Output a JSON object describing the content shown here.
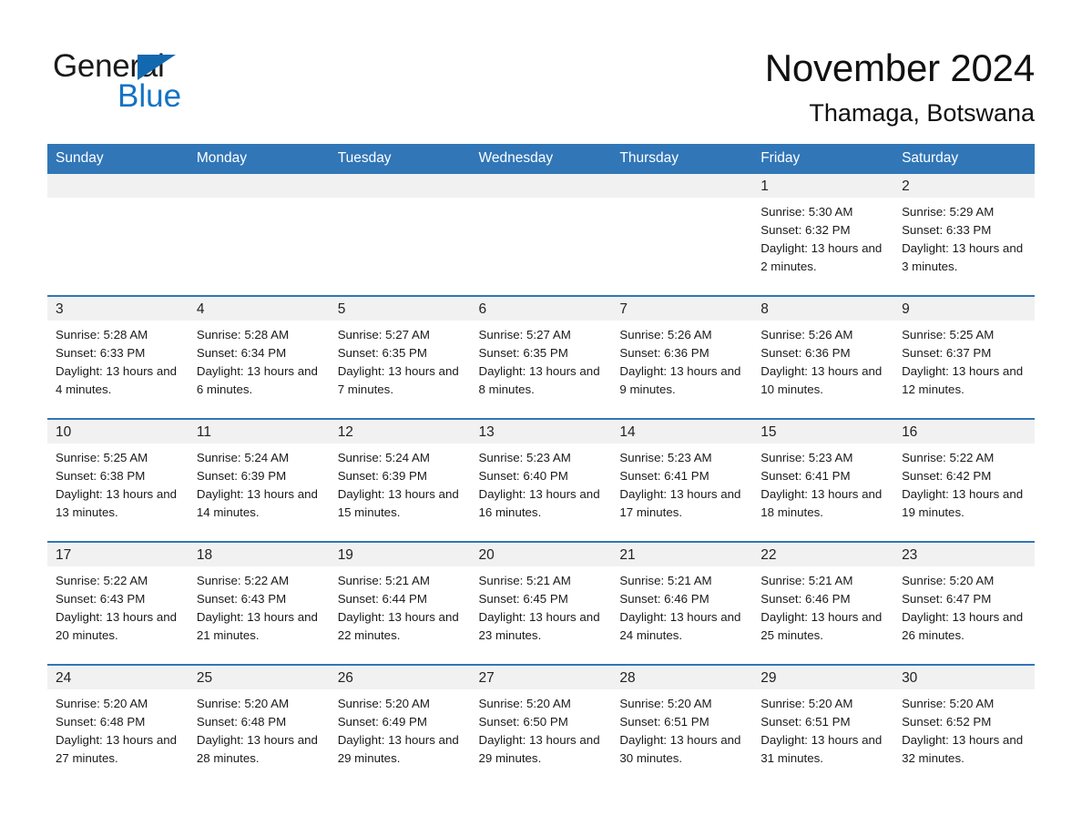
{
  "brand": {
    "name_top": "General",
    "name_bottom": "Blue",
    "triangle_color": "#1269b0",
    "blue_text_color": "#1473c4"
  },
  "header": {
    "month_title": "November 2024",
    "location": "Thamaga, Botswana"
  },
  "theme": {
    "header_blue": "#3176b7",
    "daynum_band": "#f1f1f1",
    "text": "#1a1a1a"
  },
  "weekday_headers": [
    "Sunday",
    "Monday",
    "Tuesday",
    "Wednesday",
    "Thursday",
    "Friday",
    "Saturday"
  ],
  "weeks": [
    [
      {
        "day": "",
        "sunrise": "",
        "sunset": "",
        "daylight": "",
        "empty": true
      },
      {
        "day": "",
        "sunrise": "",
        "sunset": "",
        "daylight": "",
        "empty": true
      },
      {
        "day": "",
        "sunrise": "",
        "sunset": "",
        "daylight": "",
        "empty": true
      },
      {
        "day": "",
        "sunrise": "",
        "sunset": "",
        "daylight": "",
        "empty": true
      },
      {
        "day": "",
        "sunrise": "",
        "sunset": "",
        "daylight": "",
        "empty": true
      },
      {
        "day": "1",
        "sunrise": "Sunrise: 5:30 AM",
        "sunset": "Sunset: 6:32 PM",
        "daylight": "Daylight: 13 hours and 2 minutes.",
        "empty": false
      },
      {
        "day": "2",
        "sunrise": "Sunrise: 5:29 AM",
        "sunset": "Sunset: 6:33 PM",
        "daylight": "Daylight: 13 hours and 3 minutes.",
        "empty": false
      }
    ],
    [
      {
        "day": "3",
        "sunrise": "Sunrise: 5:28 AM",
        "sunset": "Sunset: 6:33 PM",
        "daylight": "Daylight: 13 hours and 4 minutes.",
        "empty": false
      },
      {
        "day": "4",
        "sunrise": "Sunrise: 5:28 AM",
        "sunset": "Sunset: 6:34 PM",
        "daylight": "Daylight: 13 hours and 6 minutes.",
        "empty": false
      },
      {
        "day": "5",
        "sunrise": "Sunrise: 5:27 AM",
        "sunset": "Sunset: 6:35 PM",
        "daylight": "Daylight: 13 hours and 7 minutes.",
        "empty": false
      },
      {
        "day": "6",
        "sunrise": "Sunrise: 5:27 AM",
        "sunset": "Sunset: 6:35 PM",
        "daylight": "Daylight: 13 hours and 8 minutes.",
        "empty": false
      },
      {
        "day": "7",
        "sunrise": "Sunrise: 5:26 AM",
        "sunset": "Sunset: 6:36 PM",
        "daylight": "Daylight: 13 hours and 9 minutes.",
        "empty": false
      },
      {
        "day": "8",
        "sunrise": "Sunrise: 5:26 AM",
        "sunset": "Sunset: 6:36 PM",
        "daylight": "Daylight: 13 hours and 10 minutes.",
        "empty": false
      },
      {
        "day": "9",
        "sunrise": "Sunrise: 5:25 AM",
        "sunset": "Sunset: 6:37 PM",
        "daylight": "Daylight: 13 hours and 12 minutes.",
        "empty": false
      }
    ],
    [
      {
        "day": "10",
        "sunrise": "Sunrise: 5:25 AM",
        "sunset": "Sunset: 6:38 PM",
        "daylight": "Daylight: 13 hours and 13 minutes.",
        "empty": false
      },
      {
        "day": "11",
        "sunrise": "Sunrise: 5:24 AM",
        "sunset": "Sunset: 6:39 PM",
        "daylight": "Daylight: 13 hours and 14 minutes.",
        "empty": false
      },
      {
        "day": "12",
        "sunrise": "Sunrise: 5:24 AM",
        "sunset": "Sunset: 6:39 PM",
        "daylight": "Daylight: 13 hours and 15 minutes.",
        "empty": false
      },
      {
        "day": "13",
        "sunrise": "Sunrise: 5:23 AM",
        "sunset": "Sunset: 6:40 PM",
        "daylight": "Daylight: 13 hours and 16 minutes.",
        "empty": false
      },
      {
        "day": "14",
        "sunrise": "Sunrise: 5:23 AM",
        "sunset": "Sunset: 6:41 PM",
        "daylight": "Daylight: 13 hours and 17 minutes.",
        "empty": false
      },
      {
        "day": "15",
        "sunrise": "Sunrise: 5:23 AM",
        "sunset": "Sunset: 6:41 PM",
        "daylight": "Daylight: 13 hours and 18 minutes.",
        "empty": false
      },
      {
        "day": "16",
        "sunrise": "Sunrise: 5:22 AM",
        "sunset": "Sunset: 6:42 PM",
        "daylight": "Daylight: 13 hours and 19 minutes.",
        "empty": false
      }
    ],
    [
      {
        "day": "17",
        "sunrise": "Sunrise: 5:22 AM",
        "sunset": "Sunset: 6:43 PM",
        "daylight": "Daylight: 13 hours and 20 minutes.",
        "empty": false
      },
      {
        "day": "18",
        "sunrise": "Sunrise: 5:22 AM",
        "sunset": "Sunset: 6:43 PM",
        "daylight": "Daylight: 13 hours and 21 minutes.",
        "empty": false
      },
      {
        "day": "19",
        "sunrise": "Sunrise: 5:21 AM",
        "sunset": "Sunset: 6:44 PM",
        "daylight": "Daylight: 13 hours and 22 minutes.",
        "empty": false
      },
      {
        "day": "20",
        "sunrise": "Sunrise: 5:21 AM",
        "sunset": "Sunset: 6:45 PM",
        "daylight": "Daylight: 13 hours and 23 minutes.",
        "empty": false
      },
      {
        "day": "21",
        "sunrise": "Sunrise: 5:21 AM",
        "sunset": "Sunset: 6:46 PM",
        "daylight": "Daylight: 13 hours and 24 minutes.",
        "empty": false
      },
      {
        "day": "22",
        "sunrise": "Sunrise: 5:21 AM",
        "sunset": "Sunset: 6:46 PM",
        "daylight": "Daylight: 13 hours and 25 minutes.",
        "empty": false
      },
      {
        "day": "23",
        "sunrise": "Sunrise: 5:20 AM",
        "sunset": "Sunset: 6:47 PM",
        "daylight": "Daylight: 13 hours and 26 minutes.",
        "empty": false
      }
    ],
    [
      {
        "day": "24",
        "sunrise": "Sunrise: 5:20 AM",
        "sunset": "Sunset: 6:48 PM",
        "daylight": "Daylight: 13 hours and 27 minutes.",
        "empty": false
      },
      {
        "day": "25",
        "sunrise": "Sunrise: 5:20 AM",
        "sunset": "Sunset: 6:48 PM",
        "daylight": "Daylight: 13 hours and 28 minutes.",
        "empty": false
      },
      {
        "day": "26",
        "sunrise": "Sunrise: 5:20 AM",
        "sunset": "Sunset: 6:49 PM",
        "daylight": "Daylight: 13 hours and 29 minutes.",
        "empty": false
      },
      {
        "day": "27",
        "sunrise": "Sunrise: 5:20 AM",
        "sunset": "Sunset: 6:50 PM",
        "daylight": "Daylight: 13 hours and 29 minutes.",
        "empty": false
      },
      {
        "day": "28",
        "sunrise": "Sunrise: 5:20 AM",
        "sunset": "Sunset: 6:51 PM",
        "daylight": "Daylight: 13 hours and 30 minutes.",
        "empty": false
      },
      {
        "day": "29",
        "sunrise": "Sunrise: 5:20 AM",
        "sunset": "Sunset: 6:51 PM",
        "daylight": "Daylight: 13 hours and 31 minutes.",
        "empty": false
      },
      {
        "day": "30",
        "sunrise": "Sunrise: 5:20 AM",
        "sunset": "Sunset: 6:52 PM",
        "daylight": "Daylight: 13 hours and 32 minutes.",
        "empty": false
      }
    ]
  ]
}
